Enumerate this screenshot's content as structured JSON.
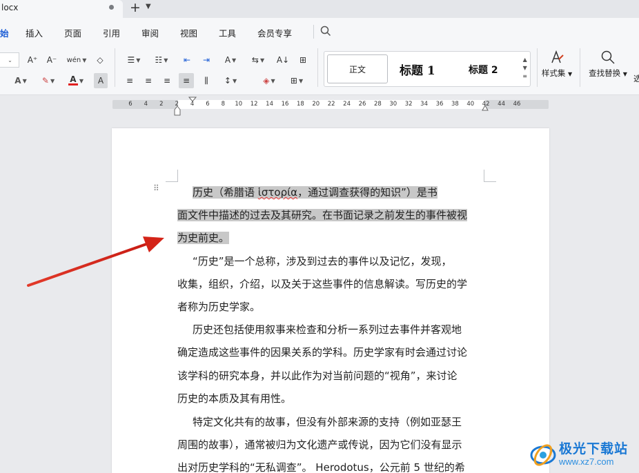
{
  "tab": {
    "filename": "locx",
    "new_tab": "+",
    "tab_menu": "⌄"
  },
  "menu": {
    "items": [
      "始",
      "插入",
      "页面",
      "引用",
      "审阅",
      "视图",
      "工具",
      "会员专享"
    ],
    "active_index": 0
  },
  "toolbar": {
    "row1": {
      "font_size_chevron": "⌄",
      "grow_font": "A⁺",
      "shrink_font": "A⁻",
      "phonetic": "wén",
      "clear_format": "◇",
      "bullets": "☰",
      "numbering": "☷",
      "outdent": "⇤",
      "indent": "⇥",
      "text_direction": "A",
      "spacing": "⇆",
      "para_mark": "A↓",
      "table": "⊞"
    },
    "row2": {
      "text_effect": "A",
      "highlight": "✎",
      "font_color": "A",
      "char_shading": "A",
      "align_left": "≡",
      "align_center": "≡",
      "align_right": "≡",
      "justify": "≡",
      "distribute": "⫼",
      "line_spacing": "↕",
      "shading": "◈",
      "border": "⊞"
    },
    "styles": {
      "normal": "正文",
      "heading1": "标题 1",
      "heading2": "标题 2"
    },
    "style_set_label": "样式集",
    "find_replace_label": "查找替换",
    "more_label": "选"
  },
  "colors": {
    "accent": "#1f5fd6",
    "font_color_bar": "#e02020",
    "highlight_bg": "#c8c8c8",
    "arrow": "#d9261c",
    "watermark": "#1a78d4"
  },
  "ruler": {
    "ticks": [
      "6",
      "4",
      "2",
      "2",
      "4",
      "6",
      "8",
      "10",
      "12",
      "14",
      "16",
      "18",
      "20",
      "22",
      "24",
      "26",
      "28",
      "30",
      "32",
      "34",
      "36",
      "38",
      "40",
      "42",
      "44",
      "46"
    ]
  },
  "document": {
    "lines": [
      {
        "text": "历史（希腊语 ",
        "extra": "ἱστορία",
        "rest": "，通过调查获得的知识”）是书",
        "highlight": true,
        "indent": true
      },
      {
        "text": "面文件中描述的过去及其研究。在书面记录之前发生的事件被视",
        "highlight": true
      },
      {
        "text": "为史前史。",
        "highlight": true
      },
      {
        "text": "“历史”是一个总称，涉及到过去的事件以及记忆，发现，",
        "indent": true
      },
      {
        "text": "收集，组织，介绍，以及关于这些事件的信息解读。写历史的学"
      },
      {
        "text": "者称为历史学家。"
      },
      {
        "text": "历史还包括使用叙事来检查和分析一系列过去事件并客观地",
        "indent": true
      },
      {
        "text": "确定造成这些事件的因果关系的学科。历史学家有时会通过讨论"
      },
      {
        "text": "该学科的研究本身，并以此作为对当前问题的“视角”，来讨论"
      },
      {
        "text": "历史的本质及其有用性。"
      },
      {
        "text": "特定文化共有的故事，但没有外部来源的支持（例如亚瑟王",
        "indent": true
      },
      {
        "text": "周围的故事），通常被归为文化遗产或传说，因为它们没有显示"
      },
      {
        "text": "出对历史学科的“无私调查”。 Herodotus，公元前 5 世纪的希"
      }
    ]
  },
  "watermark": {
    "title": "极光下载站",
    "url": "www.xz7.com"
  }
}
